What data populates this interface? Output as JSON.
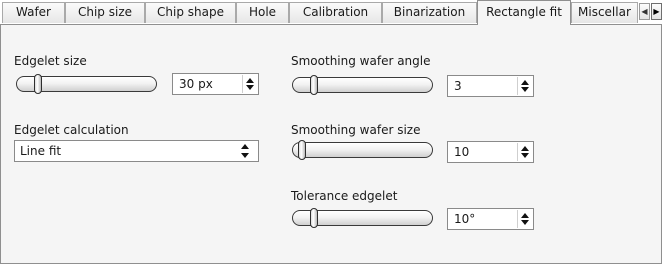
{
  "tabs": [
    {
      "label": "Wafer",
      "active": false
    },
    {
      "label": "Chip size",
      "active": false
    },
    {
      "label": "Chip shape",
      "active": false
    },
    {
      "label": "Hole",
      "active": false
    },
    {
      "label": "Calibration",
      "active": false
    },
    {
      "label": "Binarization",
      "active": false
    },
    {
      "label": "Rectangle fit",
      "active": true
    },
    {
      "label": "Miscellar",
      "active": false
    }
  ],
  "tab_scroll": {
    "left_icon": "triangle-left",
    "right_icon": "triangle-right"
  },
  "panel": {
    "edgelet_size": {
      "label": "Edgelet size",
      "value": "30 px",
      "slider_fraction": 0.1
    },
    "edgelet_calculation": {
      "label": "Edgelet calculation",
      "value": "Line fit"
    },
    "smoothing_wafer_angle": {
      "label": "Smoothing wafer angle",
      "value": "3",
      "slider_fraction": 0.1
    },
    "smoothing_wafer_size": {
      "label": "Smoothing wafer size",
      "value": "10",
      "slider_fraction": 0.0
    },
    "tolerance_edgelet": {
      "label": "Tolerance edgelet",
      "value": "10°",
      "slider_fraction": 0.1
    }
  }
}
